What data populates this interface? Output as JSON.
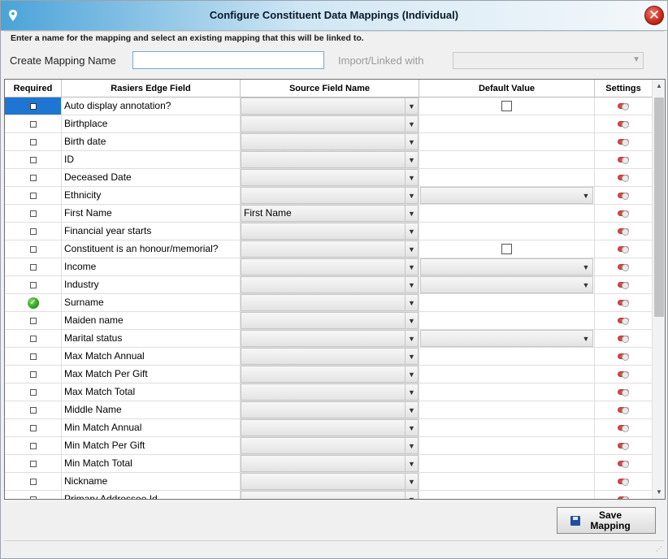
{
  "window": {
    "title": "Configure Constituent Data Mappings (Individual)",
    "close_label": "✕"
  },
  "instructions": "Enter a name for the mapping and select an existing mapping that this will be linked to.",
  "form": {
    "create_label": "Create Mapping Name",
    "create_value": "",
    "import_label": "Import/Linked with",
    "import_value": ""
  },
  "grid": {
    "columns": [
      "Required",
      "Rasiers Edge Field",
      "Source Field Name",
      "Default Value",
      "Settings"
    ],
    "rows": [
      {
        "field": "Auto display annotation?",
        "source": "",
        "default_type": "checkbox",
        "required": "selected"
      },
      {
        "field": "Birthplace",
        "source": "",
        "default_type": "text",
        "required": "unchecked"
      },
      {
        "field": "Birth date",
        "source": "",
        "default_type": "text",
        "required": "unchecked"
      },
      {
        "field": "ID",
        "source": "",
        "default_type": "text",
        "required": "unchecked"
      },
      {
        "field": "Deceased Date",
        "source": "",
        "default_type": "text",
        "required": "unchecked"
      },
      {
        "field": "Ethnicity",
        "source": "",
        "default_type": "combo",
        "required": "unchecked"
      },
      {
        "field": "First Name",
        "source": "First Name",
        "default_type": "text",
        "required": "unchecked"
      },
      {
        "field": "Financial year starts",
        "source": "",
        "default_type": "text",
        "required": "unchecked"
      },
      {
        "field": "Constituent is an honour/memorial?",
        "source": "",
        "default_type": "checkbox",
        "required": "unchecked"
      },
      {
        "field": "Income",
        "source": "",
        "default_type": "combo",
        "required": "unchecked"
      },
      {
        "field": "Industry",
        "source": "",
        "default_type": "combo",
        "required": "unchecked"
      },
      {
        "field": "Surname",
        "source": "",
        "default_type": "text",
        "required": "checked"
      },
      {
        "field": "Maiden name",
        "source": "",
        "default_type": "text",
        "required": "unchecked"
      },
      {
        "field": "Marital status",
        "source": "",
        "default_type": "combo",
        "required": "unchecked"
      },
      {
        "field": "Max Match Annual",
        "source": "",
        "default_type": "text",
        "required": "unchecked"
      },
      {
        "field": "Max Match Per Gift",
        "source": "",
        "default_type": "text",
        "required": "unchecked"
      },
      {
        "field": "Max Match Total",
        "source": "",
        "default_type": "text",
        "required": "unchecked"
      },
      {
        "field": "Middle Name",
        "source": "",
        "default_type": "text",
        "required": "unchecked"
      },
      {
        "field": "Min Match Annual",
        "source": "",
        "default_type": "text",
        "required": "unchecked"
      },
      {
        "field": "Min Match Per Gift",
        "source": "",
        "default_type": "text",
        "required": "unchecked"
      },
      {
        "field": "Min Match Total",
        "source": "",
        "default_type": "text",
        "required": "unchecked"
      },
      {
        "field": "Nickname",
        "source": "",
        "default_type": "text",
        "required": "unchecked"
      },
      {
        "field": "Primary Addressee Id",
        "source": "",
        "default_type": "text",
        "required": "unchecked"
      }
    ]
  },
  "footer": {
    "save_label_line1": "Save",
    "save_label_line2": "Mapping"
  },
  "icons": {
    "title": "map-pin-icon",
    "close": "close-icon",
    "save": "floppy-disk-icon",
    "toggle": "toggle-icon",
    "dropdown": "chevron-down-icon"
  },
  "colors": {
    "title_gradient_start": "#4aa3d8",
    "selected_cell": "#1f76d2",
    "toggle": "#d54a42",
    "required_check": "#2b9a1e"
  }
}
